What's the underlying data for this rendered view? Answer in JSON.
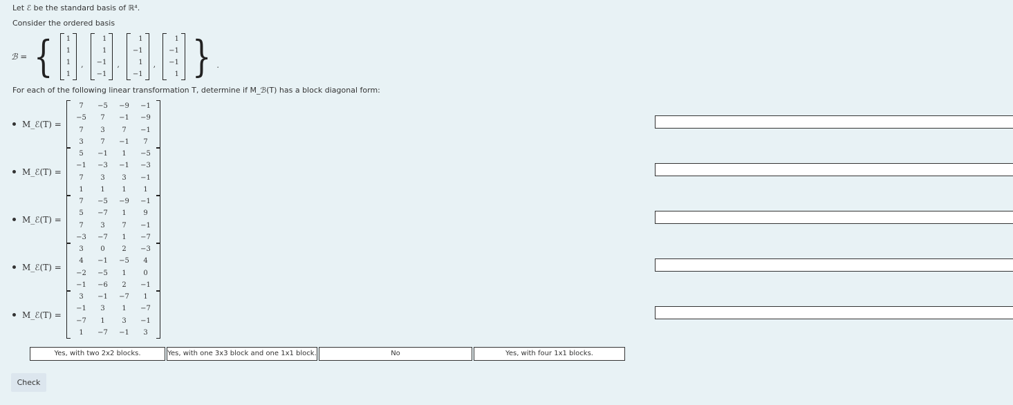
{
  "intro": {
    "line1": "Let ℰ be the standard basis of ℝ⁴.",
    "line2": "Consider the ordered basis",
    "basis_label": "ℬ =",
    "basis_vectors": [
      [
        "1",
        "1",
        "1",
        "1"
      ],
      [
        "1",
        "1",
        "−1",
        "−1"
      ],
      [
        "1",
        "−1",
        "1",
        "−1"
      ],
      [
        "1",
        "−1",
        "−1",
        "1"
      ]
    ],
    "question": "For each of the following linear transformation T, determine if M_ℬ(T) has a block diagonal form:"
  },
  "items": [
    {
      "label": "M_ℰ(T) =",
      "matrix": [
        [
          "7",
          "−5",
          "−9",
          "−1"
        ],
        [
          "−5",
          "7",
          "−1",
          "−9"
        ],
        [
          "7",
          "3",
          "7",
          "−1"
        ],
        [
          "3",
          "7",
          "−1",
          "7"
        ]
      ],
      "answer": ""
    },
    {
      "label": "M_ℰ(T) =",
      "matrix": [
        [
          "5",
          "−1",
          "1",
          "−5"
        ],
        [
          "−1",
          "−3",
          "−1",
          "−3"
        ],
        [
          "7",
          "3",
          "3",
          "−1"
        ],
        [
          "1",
          "1",
          "1",
          "1"
        ]
      ],
      "answer": ""
    },
    {
      "label": "M_ℰ(T) =",
      "matrix": [
        [
          "7",
          "−5",
          "−9",
          "−1"
        ],
        [
          "5",
          "−7",
          "1",
          "9"
        ],
        [
          "7",
          "3",
          "7",
          "−1"
        ],
        [
          "−3",
          "−7",
          "1",
          "−7"
        ]
      ],
      "answer": ""
    },
    {
      "label": "M_ℰ(T) =",
      "matrix": [
        [
          "3",
          "0",
          "2",
          "−3"
        ],
        [
          "4",
          "−1",
          "−5",
          "4"
        ],
        [
          "−2",
          "−5",
          "1",
          "0"
        ],
        [
          "−1",
          "−6",
          "2",
          "−1"
        ]
      ],
      "answer": ""
    },
    {
      "label": "M_ℰ(T) =",
      "matrix": [
        [
          "3",
          "−1",
          "−7",
          "1"
        ],
        [
          "−1",
          "3",
          "1",
          "−7"
        ],
        [
          "−7",
          "1",
          "3",
          "−1"
        ],
        [
          "1",
          "−7",
          "−1",
          "3"
        ]
      ],
      "answer": ""
    }
  ],
  "options": [
    "Yes, with two 2x2 blocks.",
    "Yes, with one 3x3 block and one 1x1 block.",
    "No",
    "Yes, with four 1x1 blocks."
  ],
  "check_label": "Check"
}
